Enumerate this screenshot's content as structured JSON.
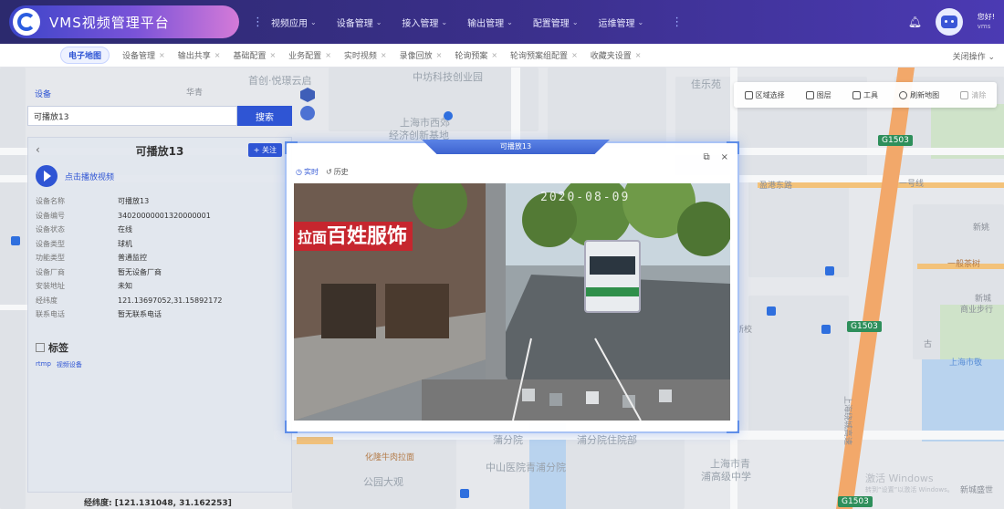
{
  "app": {
    "title": "VMS视频管理平台",
    "nav_items": [
      "视频应用",
      "设备管理",
      "接入管理",
      "输出管理",
      "配置管理",
      "运维管理"
    ],
    "user": {
      "greeting": "您好!",
      "name": "vms"
    }
  },
  "tabs": {
    "items": [
      {
        "label": "电子地图",
        "active": true
      },
      {
        "label": "设备管理",
        "active": false
      },
      {
        "label": "输出共享",
        "active": false
      },
      {
        "label": "基础配置",
        "active": false
      },
      {
        "label": "业务配置",
        "active": false
      },
      {
        "label": "实时视频",
        "active": false
      },
      {
        "label": "录像回放",
        "active": false
      },
      {
        "label": "轮询预案",
        "active": false
      },
      {
        "label": "轮询预案组配置",
        "active": false
      },
      {
        "label": "收藏夹设置",
        "active": false
      }
    ],
    "close_all": "关闭操作"
  },
  "map_tools": [
    {
      "label": "区域选择",
      "enabled": true
    },
    {
      "label": "图层",
      "enabled": true
    },
    {
      "label": "工具",
      "enabled": true
    },
    {
      "label": "刷新地图",
      "enabled": true
    },
    {
      "label": "清除",
      "enabled": false
    }
  ],
  "left_panel": {
    "tab_label": "设备",
    "search_value": "可播放13",
    "search_button": "搜索",
    "card_title": "可播放13",
    "follow_button": "+ 关注",
    "play_label": "点击播放视频",
    "info": [
      {
        "key": "设备名称",
        "value": "可播放13"
      },
      {
        "key": "设备编号",
        "value": "34020000001320000001"
      },
      {
        "key": "设备状态",
        "value": "在线"
      },
      {
        "key": "设备类型",
        "value": "球机"
      },
      {
        "key": "功能类型",
        "value": "普通监控"
      },
      {
        "key": "设备厂商",
        "value": "暂无设备厂商"
      },
      {
        "key": "安装地址",
        "value": "未知"
      },
      {
        "key": "经纬度",
        "value": "121.13697052,31.15892172"
      },
      {
        "key": "联系电话",
        "value": "暂无联系电话"
      }
    ],
    "tags_title": "标签",
    "tags": [
      "rtmp",
      "视频设备"
    ]
  },
  "modal": {
    "title": "可播放13",
    "mode_live": "实时",
    "mode_history": "历史",
    "osd_text": "2020-08-09",
    "sign_text": "百姓服饰",
    "sign_prefix": "拉面"
  },
  "map": {
    "coords": "经纬度: [121.131048, 31.162253]",
    "labels": {
      "l1": "首创·悦璟云启",
      "l2": "中坊科技创业园",
      "l3": "上海市西郊",
      "l4": "经济创新基地",
      "l5": "佳乐苑",
      "l6": "一号线",
      "l7": "新姚",
      "l8": "化隆牛肉拉面",
      "l9": "中山医院青浦分院",
      "l10": "上海市青",
      "l11": "浦高级中学",
      "l12": "上海绕城高速",
      "l13": "公园大观",
      "l14": "浦分院住院部",
      "l15": "一般茶树",
      "l16": "新城",
      "l17": "商业步行",
      "l18": "上海市敬",
      "l19": "蒲分院",
      "l20": "华青",
      "l21": "新校",
      "l22": "古",
      "l23": "盈港东路",
      "l24": "新城盛世",
      "l25": "激活 Windows",
      "l26": "转到“设置”以激活 Windows。"
    },
    "shields": [
      "G1503",
      "G1503",
      "G1503"
    ]
  }
}
